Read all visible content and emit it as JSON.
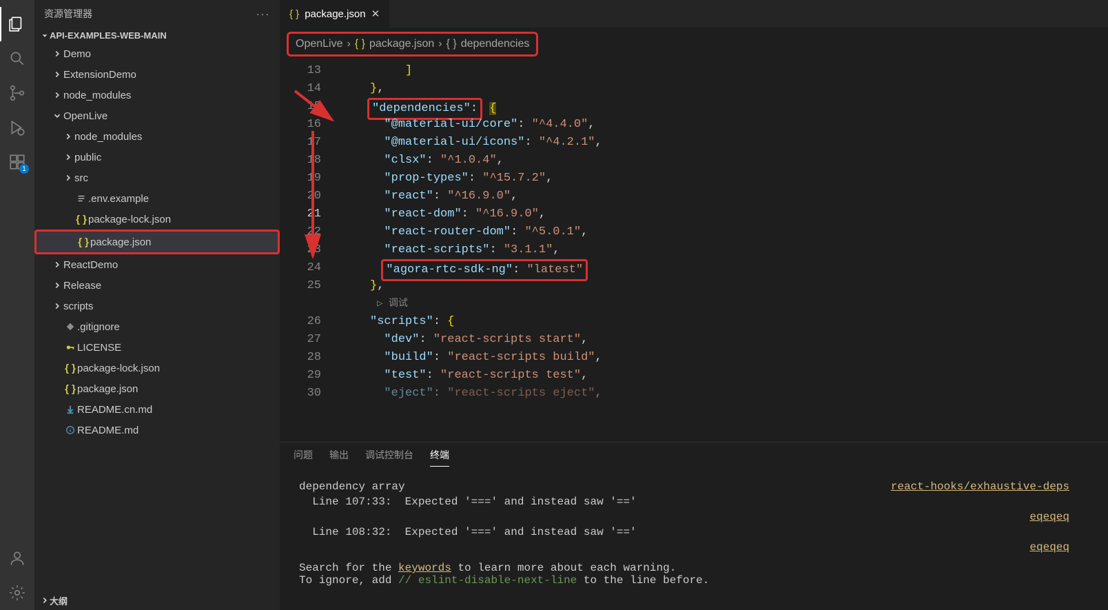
{
  "sidebar": {
    "title": "资源管理器",
    "section": "API-EXAMPLES-WEB-MAIN",
    "outline": "大纲",
    "extBadge": "1",
    "items": [
      {
        "label": "Demo",
        "type": "folder",
        "indent": 1,
        "open": false
      },
      {
        "label": "ExtensionDemo",
        "type": "folder",
        "indent": 1,
        "open": false
      },
      {
        "label": "node_modules",
        "type": "folder",
        "indent": 1,
        "open": false
      },
      {
        "label": "OpenLive",
        "type": "folder",
        "indent": 1,
        "open": true
      },
      {
        "label": "node_modules",
        "type": "folder",
        "indent": 2,
        "open": false
      },
      {
        "label": "public",
        "type": "folder",
        "indent": 2,
        "open": false
      },
      {
        "label": "src",
        "type": "folder",
        "indent": 2,
        "open": false
      },
      {
        "label": ".env.example",
        "type": "file",
        "icon": "lines",
        "color": "#c5c5c5",
        "indent": 2
      },
      {
        "label": "package-lock.json",
        "type": "file",
        "icon": "json",
        "color": "#cbcb41",
        "indent": 2
      },
      {
        "label": "package.json",
        "type": "file",
        "icon": "json",
        "color": "#cbcb41",
        "indent": 2,
        "selected": true
      },
      {
        "label": "ReactDemo",
        "type": "folder",
        "indent": 1,
        "open": false
      },
      {
        "label": "Release",
        "type": "folder",
        "indent": 1,
        "open": false
      },
      {
        "label": "scripts",
        "type": "folder",
        "indent": 1,
        "open": false
      },
      {
        "label": ".gitignore",
        "type": "file",
        "icon": "diamond",
        "color": "#8f8f8f",
        "indent": 1
      },
      {
        "label": "LICENSE",
        "type": "file",
        "icon": "key",
        "color": "#cbcb41",
        "indent": 1
      },
      {
        "label": "package-lock.json",
        "type": "file",
        "icon": "json",
        "color": "#cbcb41",
        "indent": 1
      },
      {
        "label": "package.json",
        "type": "file",
        "icon": "json",
        "color": "#cbcb41",
        "indent": 1
      },
      {
        "label": "README.cn.md",
        "type": "file",
        "icon": "down",
        "color": "#519aba",
        "indent": 1
      },
      {
        "label": "README.md",
        "type": "file",
        "icon": "info",
        "color": "#519aba",
        "indent": 1
      }
    ]
  },
  "tab": {
    "label": "package.json"
  },
  "breadcrumb": {
    "seg1": "OpenLive",
    "seg2": "package.json",
    "seg3": "dependencies"
  },
  "code": {
    "startLine": 13,
    "currentLine": 21,
    "debugHint": "调试",
    "lines": [
      {
        "n": 13,
        "t": "bracket",
        "txt": "]"
      },
      {
        "n": 14,
        "t": "closebrace",
        "txt": "},"
      },
      {
        "n": 15,
        "t": "depkey",
        "box": true
      },
      {
        "n": 16,
        "k": "@material-ui/core",
        "v": "^4.4.0",
        "c": true
      },
      {
        "n": 17,
        "k": "@material-ui/icons",
        "v": "^4.2.1",
        "c": true
      },
      {
        "n": 18,
        "k": "clsx",
        "v": "^1.0.4",
        "c": true
      },
      {
        "n": 19,
        "k": "prop-types",
        "v": "^15.7.2",
        "c": true
      },
      {
        "n": 20,
        "k": "react",
        "v": "^16.9.0",
        "c": true
      },
      {
        "n": 21,
        "k": "react-dom",
        "v": "^16.9.0",
        "c": true
      },
      {
        "n": 22,
        "k": "react-router-dom",
        "v": "^5.0.1",
        "c": true
      },
      {
        "n": 23,
        "k": "react-scripts",
        "v": "3.1.1",
        "c": true
      },
      {
        "n": 24,
        "k": "agora-rtc-sdk-ng",
        "v": "latest",
        "c": false,
        "box": true
      },
      {
        "n": 25,
        "t": "closebrace",
        "txt": "},"
      },
      {
        "n": null,
        "t": "debug"
      },
      {
        "n": 26,
        "t": "scriptkey"
      },
      {
        "n": 27,
        "k": "dev",
        "v": "react-scripts start",
        "c": true
      },
      {
        "n": 28,
        "k": "build",
        "v": "react-scripts build",
        "c": true
      },
      {
        "n": 29,
        "k": "test",
        "v": "react-scripts test",
        "c": true
      },
      {
        "n": 30,
        "k": "eject",
        "v": "react-scripts eject",
        "c": true,
        "dim": true
      }
    ],
    "keys": {
      "dependencies": "dependencies",
      "scripts": "scripts"
    }
  },
  "panel": {
    "tabs": {
      "problems": "问题",
      "output": "输出",
      "debug": "调试控制台",
      "terminal": "终端"
    },
    "content": {
      "l1": "dependency array",
      "l2": "  Line 107:33:  Expected '===' and instead saw '=='",
      "l3": "  Line 108:32:  Expected '===' and instead saw '=='",
      "l4a": "Search for the ",
      "l4b": "keywords",
      "l4c": " to learn more about each warning.",
      "l5a": "To ignore, add ",
      "l5b": "// eslint-disable-next-line",
      "l5c": " to the line before.",
      "link1": "react-hooks/exhaustive-deps",
      "link2": "eqeqeq",
      "link3": "eqeqeq"
    }
  }
}
